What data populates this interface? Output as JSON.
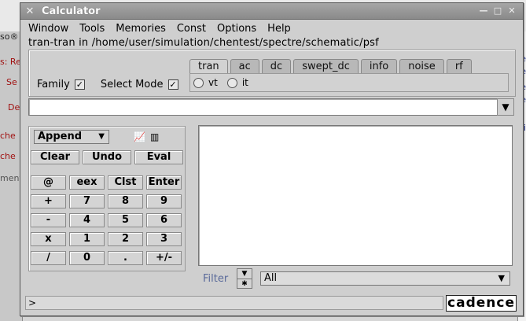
{
  "background": {
    "left_snippets": [
      "so®",
      "s: Re",
      "Se",
      "De",
      "che",
      "che",
      "ment"
    ],
    "right_snippets": [
      "re",
      "le",
      "ce",
      "e",
      "Si"
    ]
  },
  "window": {
    "title": "Calculator",
    "minimize_glyph": "—",
    "maximize_glyph": "□",
    "close_glyph": "✕"
  },
  "menu": [
    "Window",
    "Tools",
    "Memories",
    "Const",
    "Options",
    "Help"
  ],
  "path": "tran-tran in /home/user/simulation/chentest/spectre/schematic/psf",
  "family_label": "Family",
  "select_mode_label": "Select Mode",
  "tabs": [
    "tran",
    "ac",
    "dc",
    "swept_dc",
    "info",
    "noise",
    "rf"
  ],
  "radios": [
    "vt",
    "it"
  ],
  "expression_value": "",
  "append_label": "Append",
  "row_buttons": [
    "Clear",
    "Undo",
    "Eval"
  ],
  "keys": [
    [
      "@",
      "eex",
      "Clst",
      "Enter"
    ],
    [
      "+",
      "7",
      "8",
      "9"
    ],
    [
      "-",
      "4",
      "5",
      "6"
    ],
    [
      "x",
      "1",
      "2",
      "3"
    ],
    [
      "/",
      "0",
      ".",
      "+/-"
    ]
  ],
  "filter_label": "Filter",
  "filter_value": "All",
  "status_prompt": ">",
  "brand": "cadence"
}
